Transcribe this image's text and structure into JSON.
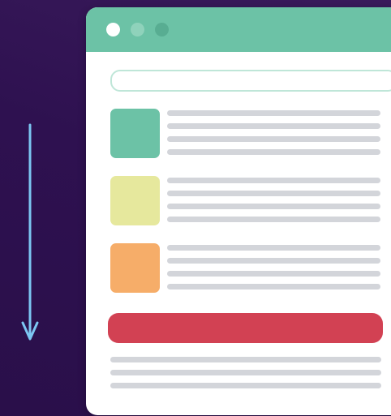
{
  "window": {
    "title": "",
    "window_controls": [
      {
        "icon": "close-dot-icon",
        "color": "#ffffff"
      },
      {
        "icon": "minimize-dot-icon",
        "color": "#8fd2bb"
      },
      {
        "icon": "maximize-dot-icon",
        "color": "#58ad92"
      }
    ],
    "titlebar_color": "#6cc2a6"
  },
  "search": {
    "value": "",
    "placeholder": ""
  },
  "list": {
    "items": [
      {
        "thumb_color": "#6cc2a6",
        "text_lines": 4
      },
      {
        "thumb_color": "#e6e89d",
        "text_lines": 4
      },
      {
        "thumb_color": "#f6ad69",
        "text_lines": 4
      }
    ]
  },
  "cta": {
    "label": "",
    "color": "#d24153"
  },
  "footer": {
    "text_lines": 3
  },
  "scroll_indicator": {
    "icon": "arrow-down-icon",
    "color": "#7cc6f2"
  },
  "colors": {
    "background": "#2f1150",
    "window": "#ffffff",
    "placeholder_line": "#d3d5da"
  }
}
